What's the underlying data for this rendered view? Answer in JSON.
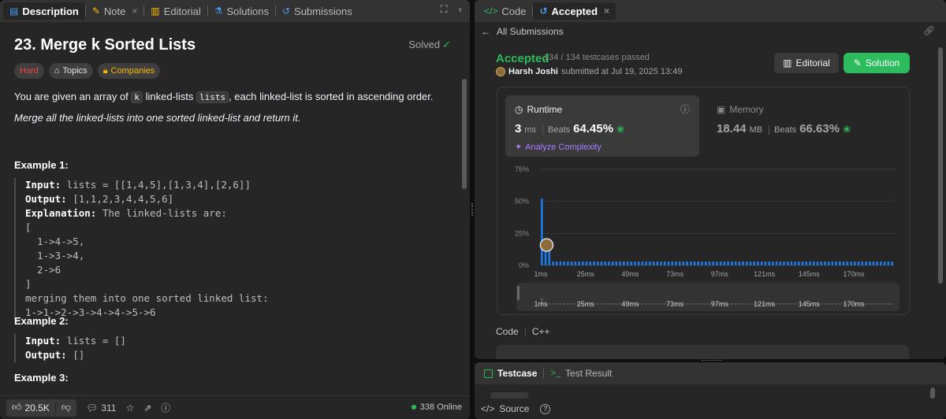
{
  "left_tabs": [
    {
      "icon": "📄",
      "label": "Description"
    },
    {
      "icon": "✎",
      "label": "Note",
      "close": "×"
    },
    {
      "icon": "📖",
      "label": "Editorial"
    },
    {
      "icon": "⚗",
      "label": "Solutions"
    },
    {
      "icon": "↺",
      "label": "Submissions"
    }
  ],
  "problem": {
    "title": "23. Merge k Sorted Lists",
    "status": "Solved",
    "tags": [
      "Hard",
      "Topics",
      "Companies"
    ],
    "desc_pre": "You are given an array of ",
    "desc_k": "k",
    "desc_mid": " linked-lists ",
    "desc_lists": "lists",
    "desc_post": ", each linked-list is sorted in ascending order.",
    "desc2": "Merge all the linked-lists into one sorted linked-list and return it.",
    "ex1_title": "Example 1:",
    "ex1_input_label": "Input:",
    "ex1_input": " lists = [[1,4,5],[1,3,4],[2,6]]",
    "ex1_output_label": "Output:",
    "ex1_output": " [1,1,2,3,4,4,5,6]",
    "ex1_expl_label": "Explanation:",
    "ex1_expl": " The linked-lists are:",
    "ex1_lines": [
      "[",
      "  1->4->5,",
      "  1->3->4,",
      "  2->6",
      "]",
      "merging them into one sorted linked list:",
      "1->1->2->3->4->4->5->6"
    ],
    "ex2_title": "Example 2:",
    "ex2_input_label": "Input:",
    "ex2_input": " lists = []",
    "ex2_output_label": "Output:",
    "ex2_output": " []",
    "ex3_title": "Example 3:"
  },
  "left_footer": {
    "likes": "20.5K",
    "comments": "311",
    "online": "338 Online"
  },
  "right_tabs": [
    {
      "icon": "</>",
      "label": "Code"
    },
    {
      "icon": "↺",
      "label": "Accepted",
      "close": "×"
    }
  ],
  "back_label": "All Submissions",
  "submission": {
    "status": "Accepted",
    "testcases": "134 / 134 testcases passed",
    "author": "Harsh Joshi",
    "submitted": "submitted at Jul 19, 2025 13:49",
    "editorial_btn": "Editorial",
    "solution_btn": "Solution",
    "runtime_label": "Runtime",
    "runtime_value": "3",
    "runtime_unit": "ms",
    "beats_label": "Beats",
    "runtime_beats": "64.45%",
    "analyze_label": "Analyze Complexity",
    "memory_label": "Memory",
    "memory_value": "18.44",
    "memory_unit": "MB",
    "memory_beats": "66.63%",
    "code_label": "Code",
    "lang": "C++"
  },
  "chart_data": {
    "type": "bar",
    "y_ticks": [
      "75%",
      "50%",
      "25%",
      "0%"
    ],
    "y_values": [
      75,
      50,
      25,
      0
    ],
    "x_ticks": [
      "1ms",
      "25ms",
      "49ms",
      "73ms",
      "97ms",
      "121ms",
      "145ms",
      "170ms"
    ],
    "values": [
      52,
      13,
      11,
      3,
      3,
      3,
      3,
      3,
      3,
      3,
      3,
      3,
      3,
      3,
      3,
      3,
      3,
      3,
      3,
      3,
      3,
      3,
      3,
      3,
      3,
      3,
      3,
      3,
      3,
      3,
      3,
      3,
      3,
      3,
      3,
      3,
      3,
      3,
      3,
      3,
      3,
      3,
      3,
      3,
      3,
      3,
      3,
      3,
      3,
      3,
      3,
      3,
      3,
      3,
      3,
      3,
      3,
      3,
      3,
      3,
      3,
      3,
      3,
      3,
      3,
      3,
      3,
      3,
      3,
      3,
      3,
      3,
      3,
      3,
      3,
      3,
      3,
      3,
      3,
      3,
      3,
      3,
      3,
      3,
      3,
      3,
      3,
      3,
      3,
      3,
      3,
      3,
      3,
      3,
      3
    ],
    "ylim": [
      0,
      75
    ],
    "highlight_index": 2,
    "bar_color": "#1c7aeb"
  },
  "bottom_tabs": [
    {
      "label": "Testcase"
    },
    {
      "label": "Test Result"
    }
  ],
  "source_label": "Source"
}
